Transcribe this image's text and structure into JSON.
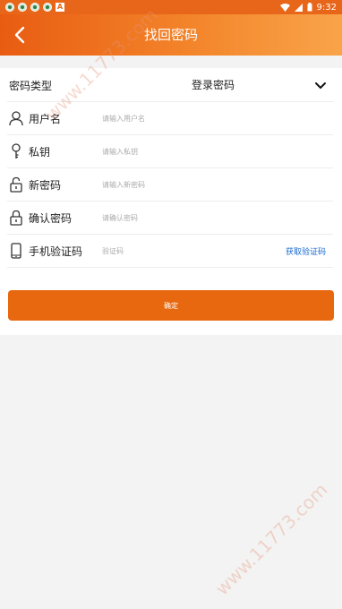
{
  "status_bar": {
    "time": "9:32",
    "colors": {
      "background": "#e8661a"
    }
  },
  "header": {
    "title": "找回密码",
    "colors": {
      "gradient_start": "#e85c12",
      "gradient_end": "#f9a44a"
    }
  },
  "form": {
    "password_type": {
      "label": "密码类型",
      "selected": "登录密码"
    },
    "username": {
      "label": "用户名",
      "placeholder": "请输入用户名"
    },
    "private_key": {
      "label": "私钥",
      "placeholder": "请输入私钥"
    },
    "new_password": {
      "label": "新密码",
      "placeholder": "请输入新密码"
    },
    "confirm_password": {
      "label": "确认密码",
      "placeholder": "请确认密码"
    },
    "sms_code": {
      "label": "手机验证码",
      "placeholder": "验证码",
      "get_code_label": "获取验证码"
    },
    "submit_label": "确定"
  },
  "watermark": "www.11773.com",
  "icons": [
    "back-arrow-icon",
    "user-icon",
    "key-icon",
    "lock-open-icon",
    "lock-icon",
    "phone-icon",
    "chevron-down-icon",
    "wifi-icon",
    "signal-icon",
    "battery-icon"
  ],
  "colors": {
    "accent": "#e8680f",
    "link": "#1b6ad1",
    "background": "#f3f3f3"
  }
}
